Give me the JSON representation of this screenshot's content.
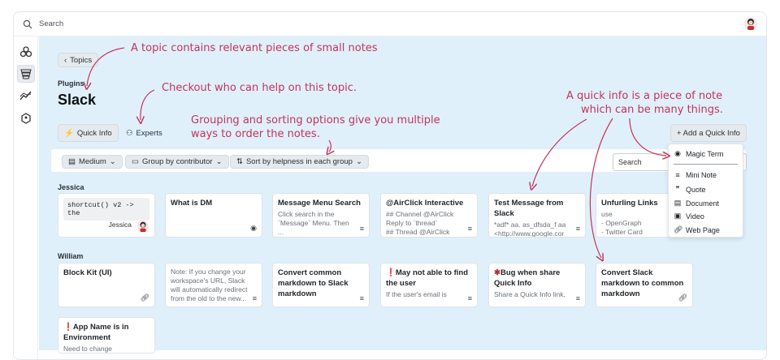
{
  "search": {
    "placeholder": "Search"
  },
  "breadcrumb": {
    "back_label": "Topics"
  },
  "page": {
    "category": "Plugins",
    "title": "Slack"
  },
  "tabs": [
    {
      "label": "Quick Info"
    },
    {
      "label": "Experts"
    }
  ],
  "add_button": {
    "label": "+ Add a Quick Info"
  },
  "toolbar": {
    "size": "Medium",
    "group": "Group by contributor",
    "sort": "Sort by helpness in each group",
    "search": "Search"
  },
  "groups": [
    {
      "name": "Jessica",
      "cards": [
        {
          "code": "shortcut() v2",
          "arrow": "-> the",
          "author": "Jessica"
        },
        {
          "title": "What is DM"
        },
        {
          "title": "Message Menu Search",
          "body": "Click search in the\n`Message` Menu. Then\n..."
        },
        {
          "title": "@AirClick Interactive",
          "body": "## Channel @AirClick\nReply to `thread`\n## Thread @AirClick"
        },
        {
          "title": "Test Message from Slack",
          "body": "*adf* aa. as_dfsda_f aa\n<http://www.google.cor\n..."
        },
        {
          "title": "Unfurling Links",
          "body": "use\n- OpenGraph\n- Twitter Card"
        }
      ]
    },
    {
      "name": "William",
      "cards": [
        {
          "title": "Block Kit (UI)"
        },
        {
          "body": "Note: If you change your\nworkspace's URL, Slack\nwill automatically redirect\nfrom the old to the new..."
        },
        {
          "title": "Convert common markdown to Slack markdown"
        },
        {
          "title": "May not able to find the user",
          "body": "If the user's email is"
        },
        {
          "title": "Bug when share Quick Info",
          "body": "Share a Quick Info link,"
        },
        {
          "title": "Convert Slack markdown to common markdown"
        },
        {
          "title": "App Name is in Environment",
          "body": "Need to change"
        }
      ]
    }
  ],
  "menu": {
    "items": [
      "Magic Term",
      "Mini Note",
      "Quote",
      "Document",
      "Video",
      "Web Page"
    ]
  },
  "annotations": {
    "a1": "A topic contains relevant pieces of small notes",
    "a2": "Checkout who can help on this topic.",
    "a3a": "Grouping and sorting options give you multiple",
    "a3b": "ways to order the notes.",
    "a4a": "A quick info is a piece of note",
    "a4b": "which can be many things."
  },
  "colors": {
    "accent": "#c43357",
    "background": "#dff0fb"
  }
}
